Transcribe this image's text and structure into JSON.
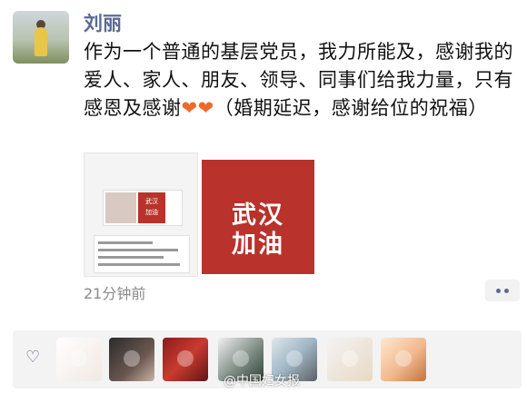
{
  "post": {
    "username": "刘丽",
    "text_before_hearts": "作为一个普通的基层党员，我力所能及，感谢我的爱人、家人、朋友、领导、同事们给我力量，只有感恩及感谢",
    "hearts": "❤❤",
    "text_after_hearts": "（婚期延迟，感谢给位的祝福）",
    "time": "21分钟前"
  },
  "images": {
    "right_poster": {
      "line1": "武汉",
      "line2": "加油"
    },
    "left_screenshot": {
      "card_label_1": "武汉",
      "card_label_2": "加油"
    }
  },
  "icons": {
    "like": "heart-outline-icon",
    "more": "more-dots-icon"
  },
  "watermark": "@中国妇女报",
  "colors": {
    "name": "#5a6a93",
    "poster_red": "#b9322c",
    "heart": "#ee6a2b"
  }
}
